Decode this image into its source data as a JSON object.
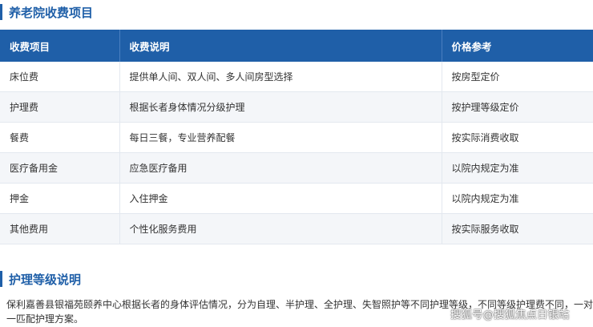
{
  "section1": {
    "title": "养老院收费项目"
  },
  "table": {
    "headers": [
      "收费项目",
      "收费说明",
      "价格参考"
    ],
    "rows": [
      [
        "床位费",
        "提供单人间、双人间、多人间房型选择",
        "按房型定价"
      ],
      [
        "护理费",
        "根据长者身体情况分级护理",
        "按护理等级定价"
      ],
      [
        "餐费",
        "每日三餐，专业营养配餐",
        "按实际消费收取"
      ],
      [
        "医疗备用金",
        "应急医疗备用",
        "以院内规定为准"
      ],
      [
        "押金",
        "入住押金",
        "以院内规定为准"
      ],
      [
        "其他费用",
        "个性化服务费用",
        "按实际服务收取"
      ]
    ]
  },
  "section2": {
    "title": "护理等级说明",
    "paragraph_line1": "保利嘉善县银福苑颐养中心根据长者的身体评估情况，分为自理、半护理、全护理、失智照护等不同护理等级，不同等级护理费不同，一对",
    "paragraph_line2": "一匹配护理方案。"
  },
  "watermark": "搜狐号@搜狐焦点日银站",
  "colors": {
    "accent": "#1f5fa8",
    "row_alt": "#f4f6f9"
  }
}
